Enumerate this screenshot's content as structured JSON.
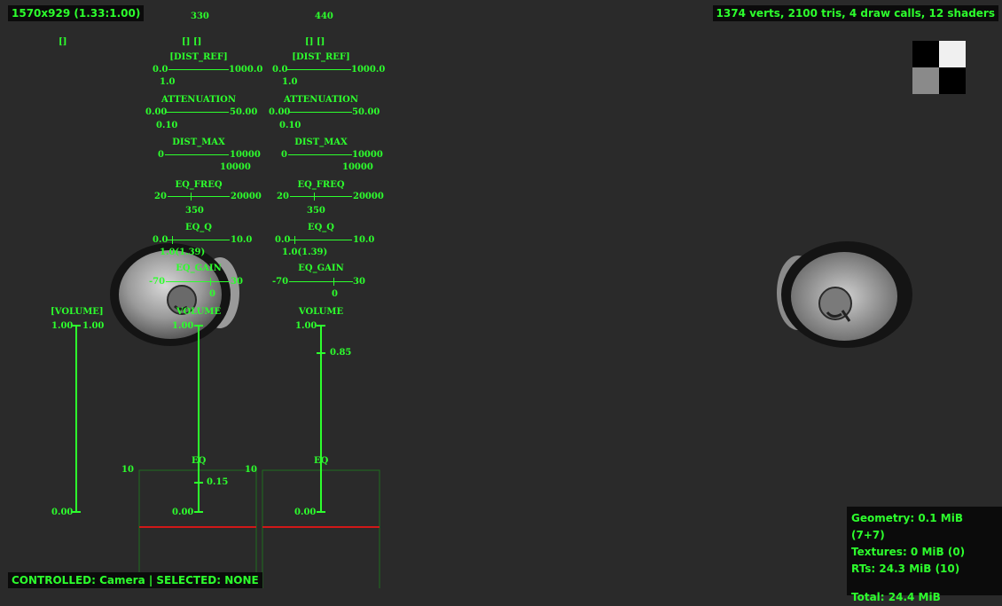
{
  "top_left_badge": "1570x929 (1.33:1.00)",
  "top_right_badge": "1374 verts, 2100 tris, 4 draw calls, 12 shaders",
  "bottom_status": "CONTROLLED: Camera | SELECTED: NONE",
  "memory": {
    "geometry": "Geometry: 0.1 MiB (7+7)",
    "textures": "Textures: 0 MiB (0)",
    "rts": "RTs: 24.3 MiB (10)",
    "total": "Total: 24.4 MiB"
  },
  "col0": {
    "toggle": "[]",
    "volume_label": "[VOLUME]",
    "vol_top_left": "1.00",
    "vol_top_right": "1.00",
    "vol_bottom": "0.00"
  },
  "col1": {
    "header": "330",
    "toggles": "[]   []",
    "dist_ref": {
      "label": "[DIST_REF]",
      "min": "0.0",
      "max": "1000.0",
      "value": "1.0"
    },
    "attenuation": {
      "label": "ATTENUATION",
      "min": "0.00",
      "max": "50.00",
      "value": "0.10"
    },
    "dist_max": {
      "label": "DIST_MAX",
      "min": "0",
      "max": "10000",
      "value": "10000"
    },
    "eq_freq": {
      "label": "EQ_FREQ",
      "min": "20",
      "max": "20000",
      "value": "350"
    },
    "eq_q": {
      "label": "EQ_Q",
      "min": "0.0",
      "max": "10.0",
      "value": "1.0(1.39)"
    },
    "eq_gain": {
      "label": "EQ_GAIN",
      "min": "-70",
      "max": "30",
      "value": "0"
    },
    "volume": {
      "label": "VOLUME",
      "top": "1.00",
      "bottom": "0.00",
      "marker": "0.15"
    },
    "eq_box": {
      "label": "EQ",
      "scale": "10"
    }
  },
  "col2": {
    "header": "440",
    "toggles": "[]   []",
    "dist_ref": {
      "label": "[DIST_REF]",
      "min": "0.0",
      "max": "1000.0",
      "value": "1.0"
    },
    "attenuation": {
      "label": "ATTENUATION",
      "min": "0.00",
      "max": "50.00",
      "value": "0.10"
    },
    "dist_max": {
      "label": "DIST_MAX",
      "min": "0",
      "max": "10000",
      "value": "10000"
    },
    "eq_freq": {
      "label": "EQ_FREQ",
      "min": "20",
      "max": "20000",
      "value": "350"
    },
    "eq_q": {
      "label": "EQ_Q",
      "min": "0.0",
      "max": "10.0",
      "value": "1.0(1.39)"
    },
    "eq_gain": {
      "label": "EQ_GAIN",
      "min": "-70",
      "max": "30",
      "value": "0"
    },
    "volume": {
      "label": "VOLUME",
      "top": "1.00",
      "bottom": "0.00",
      "marker": "0.85"
    },
    "eq_box": {
      "label": "EQ",
      "scale": "10"
    }
  },
  "colors": {
    "text_green": "#2dff2d",
    "background": "#2a2a2a",
    "eq_line_red": "#d01818",
    "eq_box_border": "#1e6e1e"
  },
  "icons": {
    "checker": "checkerboard-texture-icon",
    "speaker": "speaker-object-icon"
  }
}
